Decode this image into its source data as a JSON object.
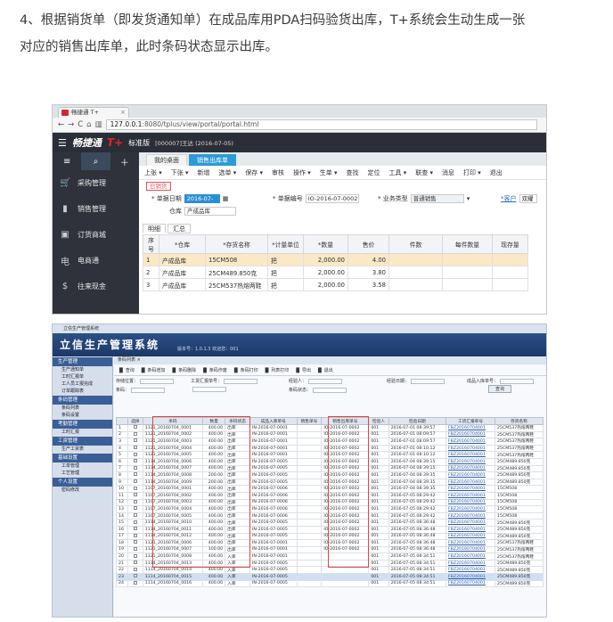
{
  "intro": {
    "line1": "4、根据销货单（即发货通知单）在成品库用PDA扫码验货出库，T+系统会生动生成一张",
    "line2": "对应的销售出库单，此时条码状态显示出库。"
  },
  "s1": {
    "browser_tab": "畅捷通 T+",
    "url_host": "127.0.0.1",
    "url_rest": ":8080/tplus/view/portal/portal.html",
    "brand": "畅捷通",
    "brand_tplus": "T+",
    "edition": "标准版",
    "user_info": "[000007]王达  (2016-07-05)",
    "side_nav": [
      {
        "icon": "cart-icon",
        "label": "采购管理"
      },
      {
        "icon": "chart-icon",
        "label": "销售管理"
      },
      {
        "icon": "shop-icon",
        "label": "订货商城"
      },
      {
        "icon": "ecommerce-icon",
        "label": "电商通"
      },
      {
        "icon": "money-icon",
        "label": "往来现金"
      }
    ],
    "window_tabs": [
      "我的桌面",
      "销售出库单"
    ],
    "toolbar": [
      "上张 ▾",
      "下张 ▾",
      "新增",
      "选单 ▾",
      "保存 ▾",
      "审核",
      "操作 ▾",
      "生单 ▾",
      "查找",
      "定位",
      "工具 ▾",
      "联查 ▾",
      "消息",
      "打印 ▾",
      "退出"
    ],
    "stamp": "已销货",
    "form": {
      "date_label": "* 单据日期",
      "date_value": "2016-07-05",
      "no_label": "* 单据编号",
      "no_value": "IO-2016-07-0002",
      "biz_label": "* 业务类型",
      "biz_value": "普通销售",
      "link": "*客户",
      "link2": "双耀",
      "wh_label": "仓库",
      "wh_value": "产成品库"
    },
    "sub_tabs": [
      "明细",
      "汇总"
    ],
    "columns": [
      "序号",
      "*仓库",
      "*存货名称",
      "*计量单位",
      "*数量",
      "售价",
      "件数",
      "每件数量",
      "现存量"
    ],
    "rows": [
      [
        "1",
        "产成品库",
        "15CM508",
        "把",
        "2,000.00",
        "4.00",
        "",
        "",
        ""
      ],
      [
        "2",
        "产成品库",
        "25CM489.850克",
        "把",
        "2,000.00",
        "3.80",
        "",
        "",
        ""
      ],
      [
        "3",
        "产成品库",
        "25CM537热熔两鞋",
        "把",
        "2,000.00",
        "3.58",
        "",
        "",
        ""
      ]
    ]
  },
  "s2": {
    "top": "立信生产管理系统",
    "title": "立信生产管理系统",
    "info": "版本号：1.0.1.3        欢迎您：001",
    "sections": [
      {
        "name": "生产管理",
        "items": [
          "生产通知单",
          "工时汇报单",
          "工人员工报完成",
          "订单跟踪表"
        ]
      },
      {
        "name": "条码管理",
        "items": [
          "条码列表",
          "条码设置"
        ]
      },
      {
        "name": "考勤管理",
        "items": [
          "工时汇报"
        ]
      },
      {
        "name": "工资管理",
        "items": [
          "生产工资表"
        ]
      },
      {
        "name": "基础设置",
        "items": [
          "工单管理",
          "工艺管理"
        ]
      },
      {
        "name": "个人设置",
        "items": [
          "密码修改"
        ]
      }
    ],
    "tab": "条码列表",
    "toolbar": [
      "查询",
      "条码增加",
      "条码删除",
      "条码作废",
      "条码打印",
      "列表打印",
      "导出",
      "退出"
    ],
    "filters": [
      "存储位置：",
      "工货汇报单号：",
      "经验人：",
      "经验日期：",
      "成品入库单号：",
      "条码：",
      "",
      "条码状态："
    ],
    "search_btn": "查询",
    "columns": [
      "",
      "选择",
      "条码",
      "数量",
      "条码状态",
      "成品入库单号",
      "销售单号",
      "销售出库单号",
      "检验人",
      "检验日期",
      "工货汇报单号",
      "存货名称"
    ],
    "rows": [
      [
        "1",
        "",
        "1121_20160704_0001",
        "400.00",
        "出库",
        "IN-2016-07-0001",
        "",
        "IO-2016-07-0002",
        "001",
        "2016-07-01 08:39:57",
        "FBZ20160704001",
        "25CM537热熔两鞋"
      ],
      [
        "2",
        "",
        "1121_20160704_0002",
        "400.00",
        "出库",
        "IN-2016-07-0001",
        "",
        "IO-2016-07-0002",
        "001",
        "2016-07-01 08:09:57",
        "FBZ20160704001",
        "25CM537热熔两鞋"
      ],
      [
        "3",
        "",
        "1121_20160704_0003",
        "400.00",
        "出库",
        "IN-2016-07-0001",
        "",
        "IO-2016-07-0002",
        "001",
        "2016-07-01 08:09:57",
        "FBZ20160704001",
        "25CM537热熔两鞋"
      ],
      [
        "4",
        "",
        "1121_20160704_0004",
        "400.00",
        "出库",
        "IN-2016-07-0001",
        "",
        "IO-2016-07-0002",
        "001",
        "2016-07-01 08:10:12",
        "FBZ20160704001",
        "25CM537热熔两鞋"
      ],
      [
        "5",
        "",
        "1121_20160704_0005",
        "400.00",
        "出库",
        "IN-2016-07-0001",
        "",
        "IO-2016-07-0002",
        "001",
        "2016-07-01 08:10:12",
        "FBZ20160704001",
        "25CM537热熔两鞋"
      ],
      [
        "6",
        "",
        "1114_20160704_0006",
        "400.00",
        "出库",
        "IN-2016-07-0005",
        "",
        "IO-2016-07-0002",
        "001",
        "2016-07-04 08:39:15",
        "FBZ20160704001",
        "25CM489.850克"
      ],
      [
        "7",
        "",
        "1114_20160704_0007",
        "400.00",
        "出库",
        "IN-2016-07-0005",
        "",
        "IO-2016-07-0002",
        "001",
        "2016-07-04 08:39:15",
        "FBZ20160704001",
        "25CM489.850克"
      ],
      [
        "8",
        "",
        "1114_20160704_0008",
        "200.00",
        "出库",
        "IN-2016-07-0005",
        "",
        "IO-2016-07-0002",
        "001",
        "2016-07-04 08:39:35",
        "FBZ20160704001",
        "25CM489.850克"
      ],
      [
        "9",
        "",
        "1114_20160704_0009",
        "200.00",
        "出库",
        "IN-2016-07-0005",
        "",
        "IO-2016-07-0002",
        "001",
        "2016-07-04 08:39:35",
        "FBZ20160704001",
        "25CM489.850克"
      ],
      [
        "10",
        "",
        "1107_20160704_0001",
        "400.00",
        "出库",
        "IN-2016-07-0006",
        "",
        "IO-2016-07-0002",
        "001",
        "2016-07-04 08:39:35",
        "FBZ20160704001",
        "15CM508"
      ],
      [
        "11",
        "",
        "1107_20160704_0002",
        "400.00",
        "出库",
        "IN-2016-07-0006",
        "",
        "IO-2016-07-0002",
        "001",
        "2016-07-05 08:29:42",
        "FBZ20160704001",
        "15CM508"
      ],
      [
        "12",
        "",
        "1107_20160704_0003",
        "400.00",
        "出库",
        "IN-2016-07-0006",
        "",
        "IO-2016-07-0002",
        "001",
        "2016-07-05 08:29:42",
        "FBZ20160704001",
        "15CM508"
      ],
      [
        "13",
        "",
        "1107_20160704_0004",
        "400.00",
        "出库",
        "IN-2016-07-0006",
        "",
        "IO-2016-07-0002",
        "001",
        "2016-07-05 08:29:42",
        "FBZ20160704001",
        "15CM508"
      ],
      [
        "14",
        "",
        "1107_20160704_0005",
        "400.00",
        "出库",
        "IN-2016-07-0006",
        "",
        "IO-2016-07-0002",
        "001",
        "2016-07-05 08:29:42",
        "FBZ20160704001",
        "15CM508"
      ],
      [
        "15",
        "",
        "1114_20160704_0010",
        "400.00",
        "出库",
        "IN-2016-07-0005",
        "",
        "IO-2016-07-0002",
        "001",
        "2016-07-05 08:36:48",
        "FBZ20160704001",
        "25CM489.850克"
      ],
      [
        "16",
        "",
        "1114_20160704_0011",
        "400.00",
        "出库",
        "IN-2016-07-0005",
        "",
        "IO-2016-07-0002",
        "001",
        "2016-07-05 08:36:48",
        "FBZ20160704001",
        "25CM489.850克"
      ],
      [
        "17",
        "",
        "1114_20160704_0012",
        "400.00",
        "出库",
        "IN-2016-07-0005",
        "",
        "IO-2016-07-0002",
        "001",
        "2016-07-05 08:36:48",
        "FBZ20160704001",
        "25CM489.850克"
      ],
      [
        "18",
        "",
        "1121_20160704_0006",
        "400.00",
        "出库",
        "IN-2016-07-0001",
        "",
        "IO-2016-07-0002",
        "001",
        "2016-07-05 08:36:48",
        "FBZ20160704001",
        "25CM537热熔两鞋"
      ],
      [
        "19",
        "",
        "1121_20160704_0007",
        "100.00",
        "出库",
        "IN-2016-07-0001",
        "",
        "IO-2016-07-0002",
        "001",
        "2016-07-05 08:36:48",
        "FBZ20160704001",
        "25CM537热熔两鞋"
      ],
      [
        "20",
        "",
        "1121_20160704_0008",
        "400.00",
        "入库",
        "IN-2016-07-0001",
        "",
        "",
        "001",
        "2016-07-05 08:34:51",
        "FBZ20160704001",
        "25CM537热熔两鞋"
      ],
      [
        "21",
        "",
        "1114_20160704_0013",
        "400.00",
        "入库",
        "IN-2016-07-0005",
        "",
        "",
        "001",
        "2016-07-05 08:34:51",
        "FBZ20160704001",
        "25CM489.850克"
      ],
      [
        "22",
        "",
        "1114_20160704_0014",
        "400.00",
        "入库",
        "IN-2016-07-0005",
        "",
        "",
        "001",
        "2016-07-05 08:34:51",
        "FBZ20160704001",
        "25CM489.850克"
      ],
      [
        "23",
        "",
        "1114_20160704_0015",
        "400.00",
        "入库",
        "IN-2016-07-0005",
        "",
        "",
        "001",
        "2016-07-05 08:34:51",
        "FBZ20160704001",
        "25CM489.850克"
      ],
      [
        "24",
        "",
        "1114_20160704_0016",
        "400.00",
        "入库",
        "IN-2016-07-0005",
        "",
        "",
        "001",
        "2016-07-05 08:34:51",
        "FBZ20160704001",
        "25CM489.850克"
      ]
    ]
  }
}
